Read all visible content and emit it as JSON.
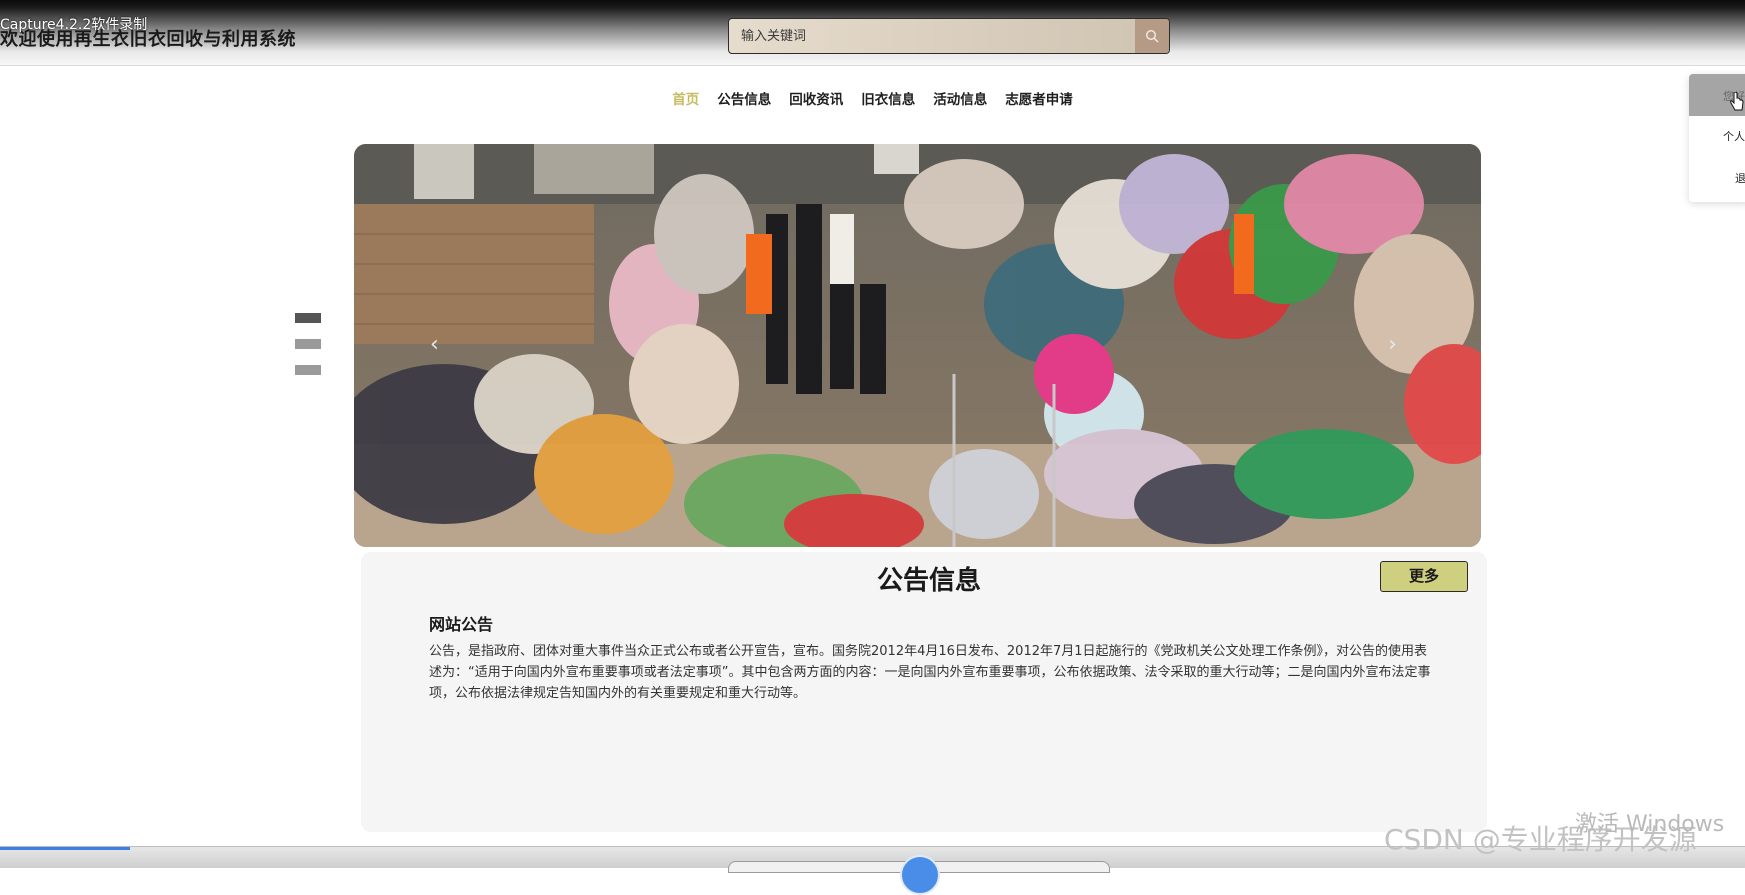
{
  "capture_tag": "Capture4.2.2软件录制",
  "site_title": "欢迎使用再生衣旧衣回收与利用系统",
  "search": {
    "placeholder": "输入关键词"
  },
  "nav": [
    {
      "label": "首页",
      "active": true
    },
    {
      "label": "公告信息"
    },
    {
      "label": "回收资讯"
    },
    {
      "label": "旧衣信息"
    },
    {
      "label": "活动信息"
    },
    {
      "label": "志愿者申请"
    }
  ],
  "user_menu": {
    "header": "您好",
    "items": [
      "个人",
      "退"
    ]
  },
  "carousel": {
    "slide_count": 3,
    "active_index": 0
  },
  "notice_section": {
    "title": "公告信息",
    "more_label": "更多",
    "item_title": "网站公告",
    "item_body": "公告，是指政府、团体对重大事件当众正式公布或者公开宣告，宣布。国务院2012年4月16日发布、2012年7月1日起施行的《党政机关公文处理工作条例》，对公告的使用表述为：“适用于向国内外宣布重要事项或者法定事项”。其中包含两方面的内容：一是向国内外宣布重要事项，公布依据政策、法令采取的重大行动等；二是向国内外宣布法定事项，公布依据法律规定告知国内外的有关重要规定和重大行动等。"
  },
  "watermarks": {
    "windows": "激活 Windows",
    "csdn": "CSDN @专业程序开发源"
  },
  "colors": {
    "accent_nav": "#c7bb62",
    "more_button": "#cfcf80"
  }
}
